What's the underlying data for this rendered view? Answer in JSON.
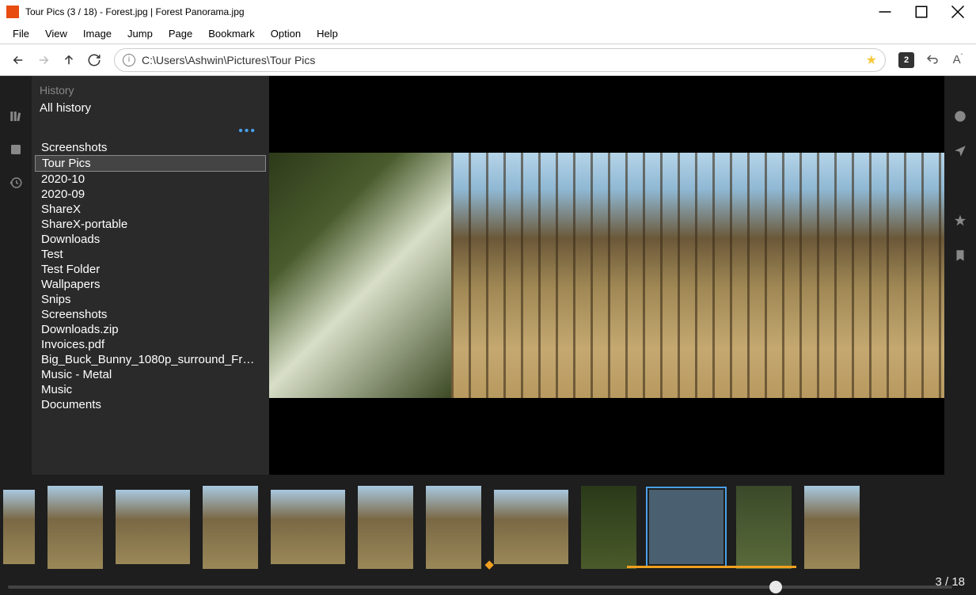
{
  "window": {
    "title": "Tour Pics (3 / 18) - Forest.jpg | Forest Panorama.jpg"
  },
  "menu": {
    "file": "File",
    "view": "View",
    "image": "Image",
    "jump": "Jump",
    "page": "Page",
    "bookmark": "Bookmark",
    "option": "Option",
    "help": "Help"
  },
  "address": {
    "path": "C:\\Users\\Ashwin\\Pictures\\Tour Pics"
  },
  "toolbar": {
    "badge": "2"
  },
  "history": {
    "header": "History",
    "all": "All history",
    "more": "•••",
    "items": [
      "Screenshots",
      "Tour Pics",
      "2020-10",
      "2020-09",
      "ShareX",
      "ShareX-portable",
      "Downloads",
      "Test",
      "Test Folder",
      "Wallpapers",
      "Snips",
      "Screenshots",
      "Downloads.zip",
      "Invoices.pdf",
      "Big_Buck_Bunny_1080p_surround_Fros...",
      "Music - Metal",
      "Music",
      "Documents"
    ],
    "selected_index": 1
  },
  "page_indicator": "3 / 18"
}
